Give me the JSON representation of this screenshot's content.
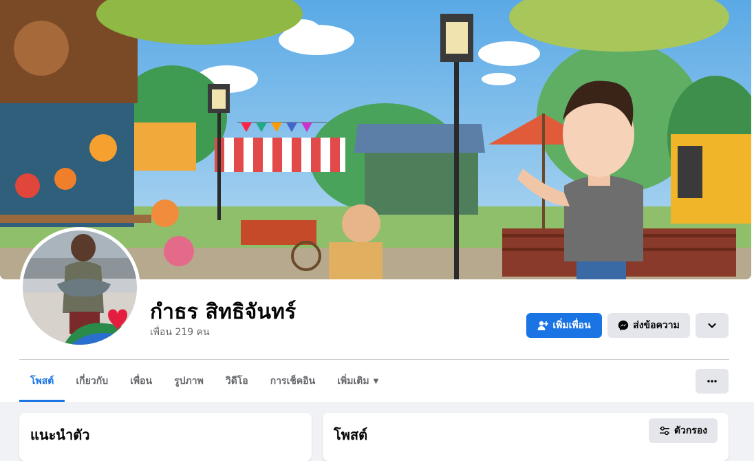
{
  "profile": {
    "name": "กำธร สิทธิจันทร์",
    "friends": "เพื่อน 219 คน"
  },
  "actions": {
    "add_friend": "เพิ่มเพื่อน",
    "message": "ส่งข้อความ"
  },
  "tabs": [
    {
      "label": "โพสต์",
      "active": true
    },
    {
      "label": "เกี่ยวกับ"
    },
    {
      "label": "เพื่อน"
    },
    {
      "label": "รูปภาพ"
    },
    {
      "label": "วิดีโอ"
    },
    {
      "label": "การเช็คอิน"
    },
    {
      "label": "เพิ่มเติม"
    }
  ],
  "intro": {
    "title": "แนะนำตัว"
  },
  "posts": {
    "title": "โพสต์",
    "filter_label": "ตัวกรอง"
  },
  "colors": {
    "accent": "#1b74e4",
    "page_bg": "#f0f2f5",
    "button_gray": "#e4e6eb"
  },
  "icons": [
    "add-friend-icon",
    "messenger-icon",
    "chevron-down-icon",
    "more-dots-icon",
    "filter-icon",
    "heart-badge-icon"
  ]
}
